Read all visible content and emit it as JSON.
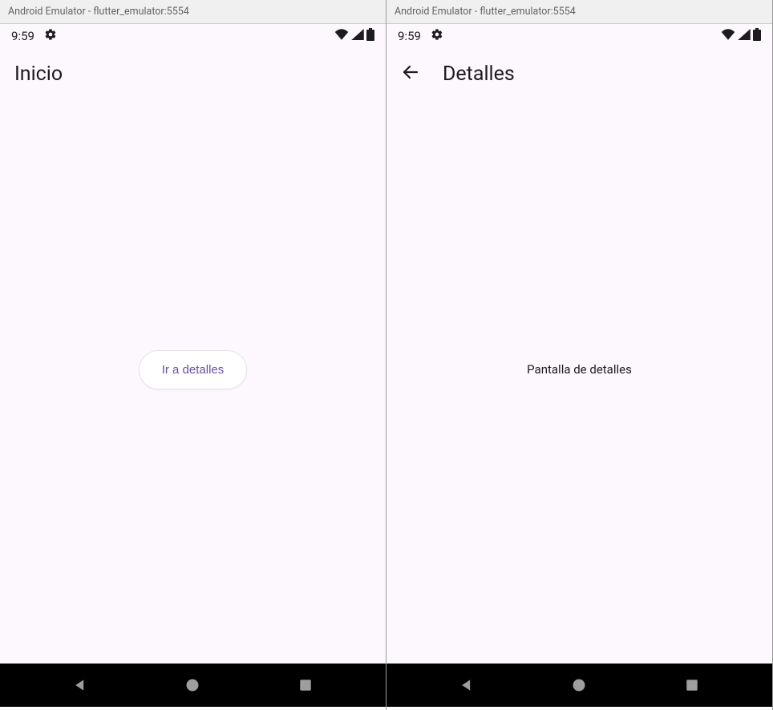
{
  "window_title": "Android Emulator - flutter_emulator:5554",
  "status": {
    "time": "9:59"
  },
  "left": {
    "title": "Inicio",
    "button_label": "Ir a detalles"
  },
  "right": {
    "title": "Detalles",
    "body_text": "Pantalla de detalles"
  }
}
